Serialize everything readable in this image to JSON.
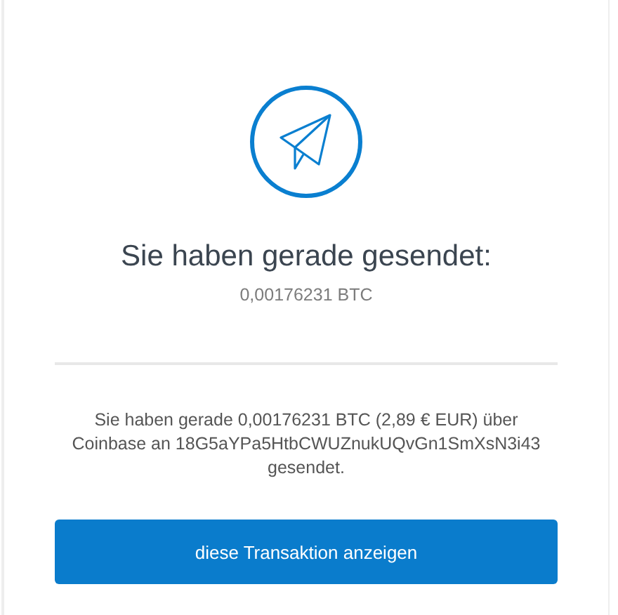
{
  "title": "Sie haben gerade gesendet:",
  "amount": "0,00176231 BTC",
  "message": "Sie haben gerade 0,00176231 BTC (2,89 € EUR) über Coinbase an 18G5aYPa5HtbCWUZnukUQvGn1SmXsN3i43 gesendet.",
  "button": "diese Transaktion anzeigen"
}
